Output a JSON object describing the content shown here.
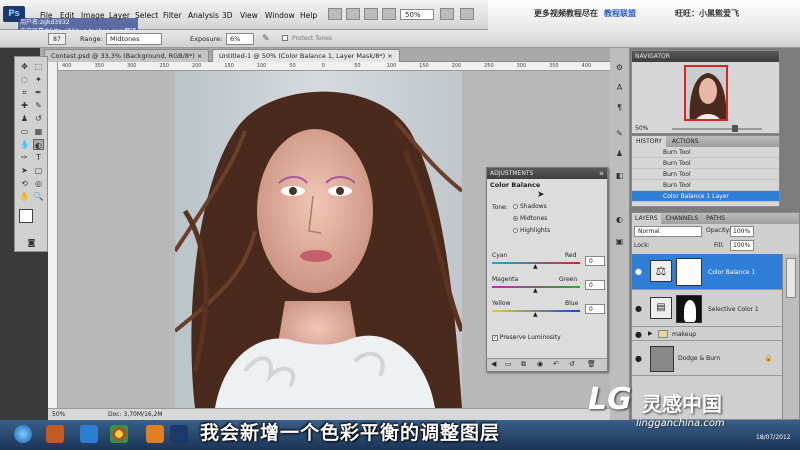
{
  "menubar": {
    "app_icon": "Ps",
    "items": [
      "File",
      "Edit",
      "Image",
      "Layer",
      "Select",
      "Filter",
      "Analysis",
      "3D",
      "View",
      "Window",
      "Help"
    ],
    "zoom": "50%"
  },
  "promo": {
    "text": "更多视频教程尽在",
    "highlight": "教程联盟",
    "brand": "旺旺：小黑熊爱飞"
  },
  "watermark": {
    "user": "用户名:zgkd3932",
    "shop": "中文字幕由http://hbbyo.taobao.com翻译"
  },
  "options": {
    "brush_size": "87",
    "range_label": "Range:",
    "range_value": "Midtones",
    "exposure_label": "Exposure:",
    "exposure_value": "6%",
    "protect_tones": "Protect Tones"
  },
  "tabs": [
    {
      "label": "Contest.psd @ 33,3% (Background, RGB/8*)"
    },
    {
      "label": "Untitled-1 @ 50% (Color Balance 1, Layer Mask/8*)"
    }
  ],
  "ruler_ticks": [
    "400",
    "350",
    "300",
    "250",
    "200",
    "150",
    "100",
    "50",
    "0",
    "50",
    "100",
    "150",
    "200",
    "250",
    "300",
    "350",
    "400"
  ],
  "statusbar": {
    "zoom": "50%",
    "doc": "Doc: 3,70M/16,2M"
  },
  "navigator": {
    "title": "NAVIGATOR",
    "zoom": "50%"
  },
  "history": {
    "tabs": [
      "HISTORY",
      "ACTIONS"
    ],
    "items": [
      "Burn Tool",
      "Burn Tool",
      "Burn Tool",
      "Burn Tool",
      "Color Balance 1 Layer"
    ],
    "selected_index": 4
  },
  "layers": {
    "tabs": [
      "LAYERS",
      "CHANNELS",
      "PATHS"
    ],
    "blend_mode": "Normal",
    "opacity_label": "Opacity:",
    "opacity": "100%",
    "lock_label": "Lock:",
    "fill_label": "Fill:",
    "fill": "100%",
    "items": [
      {
        "name": "Color Balance 1",
        "selected": true
      },
      {
        "name": "Selective Color 1",
        "selected": false
      },
      {
        "name": "makeup",
        "selected": false
      },
      {
        "name": "Dodge & Burn",
        "selected": false
      }
    ]
  },
  "adjustments": {
    "title": "ADJUSTMENTS",
    "subtitle": "Color Balance",
    "tone_label": "Tone:",
    "tones": [
      "Shadows",
      "Midtones",
      "Highlights"
    ],
    "selected_tone": "Midtones",
    "sliders": [
      {
        "left": "Cyan",
        "right": "Red",
        "value": "0",
        "colors": [
          "#00b4d8",
          "#e02020"
        ]
      },
      {
        "left": "Magenta",
        "right": "Green",
        "value": "0",
        "colors": [
          "#d020c0",
          "#20b020"
        ]
      },
      {
        "left": "Yellow",
        "right": "Blue",
        "value": "0",
        "colors": [
          "#e0d020",
          "#2040e0"
        ]
      }
    ],
    "preserve": "Preserve Luminosity"
  },
  "subtitle": "我会新增一个色彩平衡的调整图层",
  "logo": {
    "cn": "灵感中国",
    "site": "lingganchina.com",
    "date": "18/07/2012"
  },
  "accent": "#2f7ed8"
}
